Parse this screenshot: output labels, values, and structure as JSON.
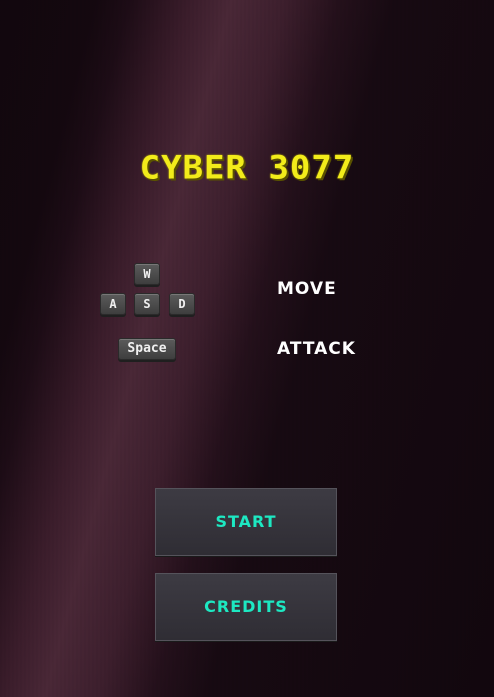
{
  "game": {
    "title": "CYBER 3077"
  },
  "controls": {
    "keys": {
      "w": "W",
      "a": "A",
      "s": "S",
      "d": "D",
      "space": "Space"
    },
    "move_label": "MOVE",
    "attack_label": "ATTACK"
  },
  "menu": {
    "start_label": "START",
    "credits_label": "CREDITS"
  },
  "colors": {
    "title": "#f2ec1a",
    "button_text": "#1de8c2",
    "background": "#14080f"
  }
}
